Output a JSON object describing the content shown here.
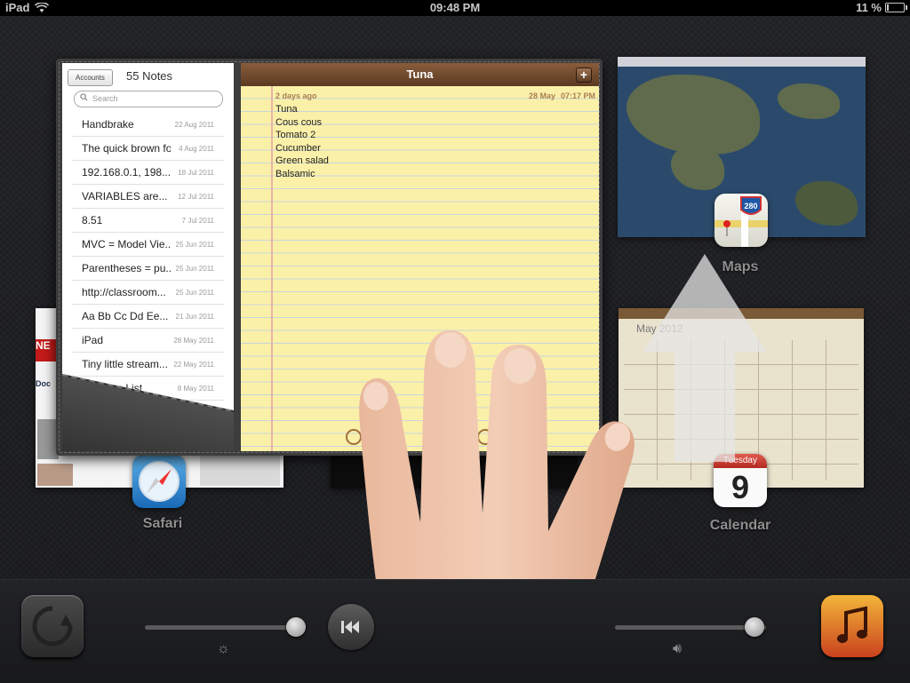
{
  "status_bar": {
    "device": "iPad",
    "time": "09:48 PM",
    "battery": "11 %",
    "battery_level": 0.11
  },
  "app_switcher": {
    "apps": [
      {
        "label": "Maps",
        "icon": "maps-280-icon"
      },
      {
        "label": "Calendar",
        "icon": "calendar-icon",
        "weekday": "Tuesday",
        "day": "9",
        "month_shown": "May 2012"
      },
      {
        "label": "Safari",
        "icon": "safari-compass-icon",
        "page_text": "NE",
        "page_label": "Doc"
      },
      {
        "label": "",
        "icon": "app-icon"
      }
    ]
  },
  "notes": {
    "accounts_button": "Accounts",
    "list_title": "55 Notes",
    "search_placeholder": "Search",
    "items": [
      {
        "title": "Handbrake",
        "date": "22 Aug 2011"
      },
      {
        "title": "The quick brown fo...",
        "date": "4 Aug 2011"
      },
      {
        "title": "192.168.0.1, 198....",
        "date": "18 Jul 2011"
      },
      {
        "title": "VARIABLES are...",
        "date": "12 Jul 2011"
      },
      {
        "title": "8.51",
        "date": "7 Jul 2011"
      },
      {
        "title": "MVC = Model Vie...",
        "date": "25 Jun 2011"
      },
      {
        "title": "Parentheses = pu...",
        "date": "25 Jun 2011"
      },
      {
        "title": "http://classroom...",
        "date": "25 Jun 2011"
      },
      {
        "title": "Aa Bb Cc Dd Ee...",
        "date": "21 Jun 2011"
      },
      {
        "title": "iPad",
        "date": "28 May 2011"
      },
      {
        "title": "Tiny little stream...",
        "date": "22 May 2011"
      },
      {
        "title": "Revision List",
        "date": "8 May 2011"
      }
    ],
    "note": {
      "title": "Tuna",
      "add_button": "+",
      "relative_date": "2 days ago",
      "date": "28 May",
      "time": "07:17 PM",
      "lines": [
        "Tuna",
        "Cous cous",
        "Tomato 2",
        "Cucumber",
        "Green salad",
        "Balsamic"
      ]
    }
  },
  "dock": {
    "rotation_lock_icon": "rotation-lock-icon",
    "brightness_icon": "sun-icon",
    "previous_icon": "previous-track-icon",
    "volume_icon": "speaker-icon",
    "music_icon": "music-note-icon"
  },
  "gesture": {
    "direction": "up",
    "fingers": 4
  }
}
